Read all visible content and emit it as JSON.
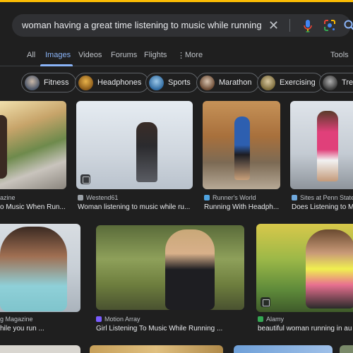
{
  "search": {
    "query": "woman having a great time listening to music while running"
  },
  "tabs": [
    {
      "label": "All"
    },
    {
      "label": "Images",
      "active": true
    },
    {
      "label": "Videos"
    },
    {
      "label": "Forums"
    },
    {
      "label": "Flights"
    },
    {
      "label": "More"
    }
  ],
  "tools_label": "Tools",
  "chips": [
    {
      "label": "Fitness"
    },
    {
      "label": "Headphones"
    },
    {
      "label": "Sports"
    },
    {
      "label": "Marathon"
    },
    {
      "label": "Exercising"
    },
    {
      "label": "Trea"
    }
  ],
  "results": [
    {
      "source": "azine",
      "title": "o Music When Run..."
    },
    {
      "source": "Westend61",
      "title": "Woman listening to music while ru..."
    },
    {
      "source": "Runner's World",
      "title": "Running With Headph..."
    },
    {
      "source": "Sites at Penn State",
      "title": "Does Listening to M"
    },
    {
      "source": "g Magazine",
      "title": "hile you run ..."
    },
    {
      "source": "Motion Array",
      "title": "Girl Listening To Music While Running ..."
    },
    {
      "source": "Alamy",
      "title": "beautiful woman running in au"
    }
  ],
  "colors": {
    "background": "#1f1f1f",
    "search_bar": "#303134",
    "accent": "#8ab4f8",
    "top_bar": "#fbbc04"
  }
}
